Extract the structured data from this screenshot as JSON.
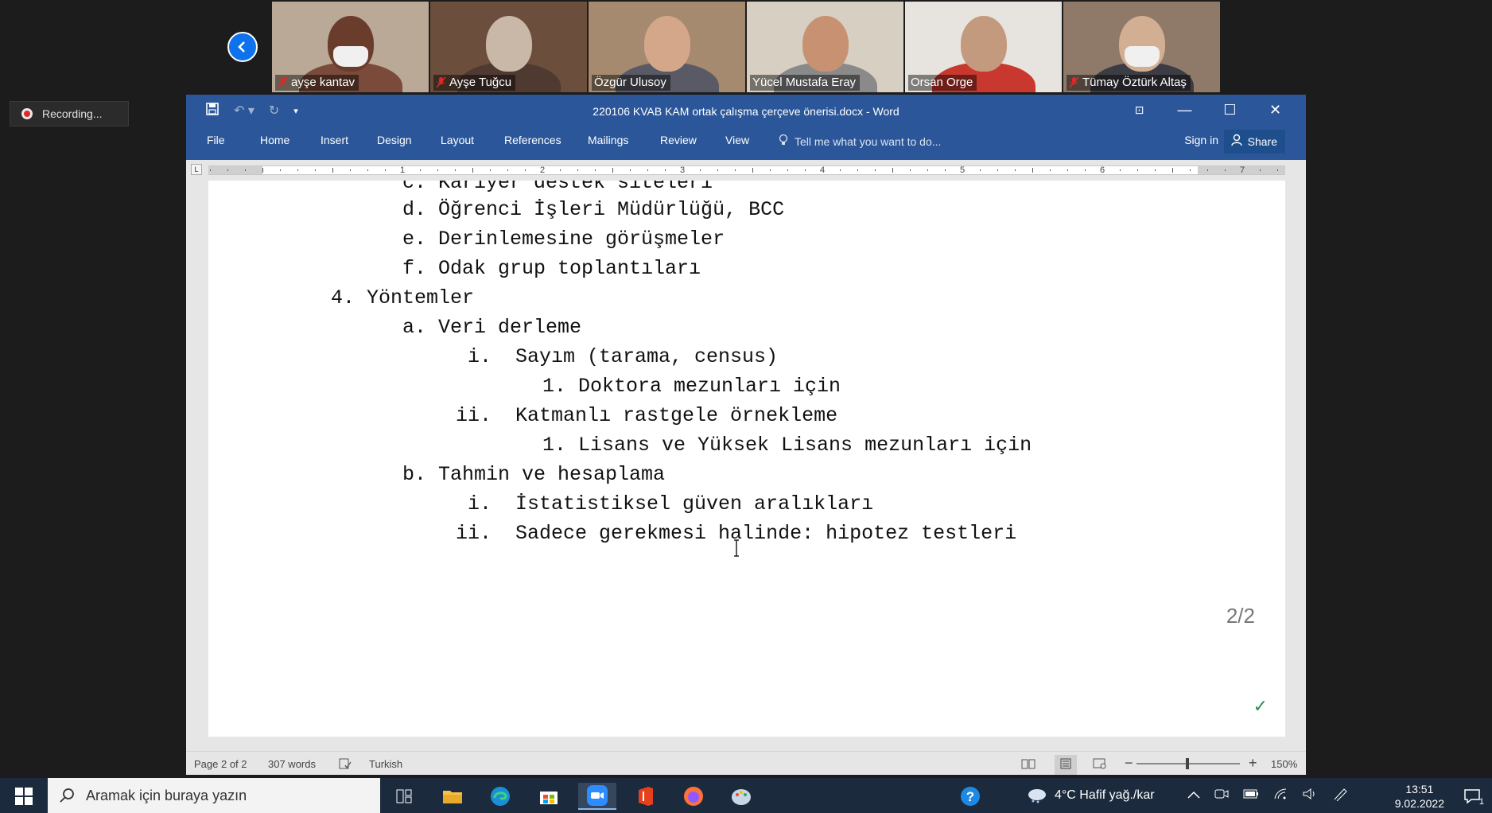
{
  "zoom": {
    "participants": [
      {
        "name": "ayşe kantav",
        "muted": true,
        "bg": "#b9a996",
        "head": "#6a3c2b",
        "body": "#7a4a3a",
        "mask": true
      },
      {
        "name": "Ayşe Tuğcu",
        "muted": true,
        "bg": "#6b4e3c",
        "head": "#c9b8a8",
        "body": "#4e3a30",
        "mask": false
      },
      {
        "name": "Özgür Ulusoy",
        "muted": false,
        "bg": "#a58a70",
        "head": "#d4a78a",
        "body": "#5a5a66",
        "mask": false
      },
      {
        "name": "Yücel Mustafa Eray",
        "muted": false,
        "bg": "#d6cfc2",
        "head": "#c89272",
        "body": "#8a8a8a",
        "mask": false
      },
      {
        "name": "Orsan Orge",
        "muted": false,
        "bg": "#e7e3de",
        "head": "#c49a7e",
        "body": "#c8382e",
        "mask": false
      },
      {
        "name": "Tümay Öztürk Altaş",
        "muted": true,
        "bg": "#8f7a6a",
        "head": "#d2ae92",
        "body": "#3c3c44",
        "mask": true
      }
    ],
    "recording_label": "Recording..."
  },
  "word": {
    "title": "220106 KVAB KAM ortak çalışma çerçeve önerisi.docx - Word",
    "tabs": [
      "File",
      "Home",
      "Insert",
      "Design",
      "Layout",
      "References",
      "Mailings",
      "Review",
      "View"
    ],
    "tell_me": "Tell me what you want to do...",
    "sign_in": "Sign in",
    "share": "Share",
    "ruler_numbers": [
      "1",
      "2",
      "3",
      "4",
      "5",
      "6",
      "7"
    ],
    "document_lines": [
      "c. Kariyer destek siteleri",
      "d. Öğrenci İşleri Müdürlüğü, BCC",
      "e. Derinlemesine görüşmeler",
      "f. Odak grup toplantıları",
      "4. Yöntemler",
      "a. Veri derleme",
      "i.  Sayım (tarama, census)",
      "1. Doktora mezunları için",
      "ii.  Katmanlı rastgele örnekleme",
      "1. Lisans ve Yüksek Lisans mezunları için",
      "b. Tahmin ve hesaplama",
      "i.  İstatistiksel güven aralıkları",
      "ii.  Sadece gerekmesi halinde: hipotez testleri"
    ],
    "page_indicator": "2/2",
    "status": {
      "page": "Page 2 of 2",
      "words": "307 words",
      "language": "Turkish",
      "zoom": "150%"
    }
  },
  "taskbar": {
    "search_placeholder": "Aramak için buraya yazın",
    "weather": "4°C  Hafif yağ./kar",
    "time": "13:51",
    "date": "9.02.2022",
    "notification_count": "1"
  }
}
